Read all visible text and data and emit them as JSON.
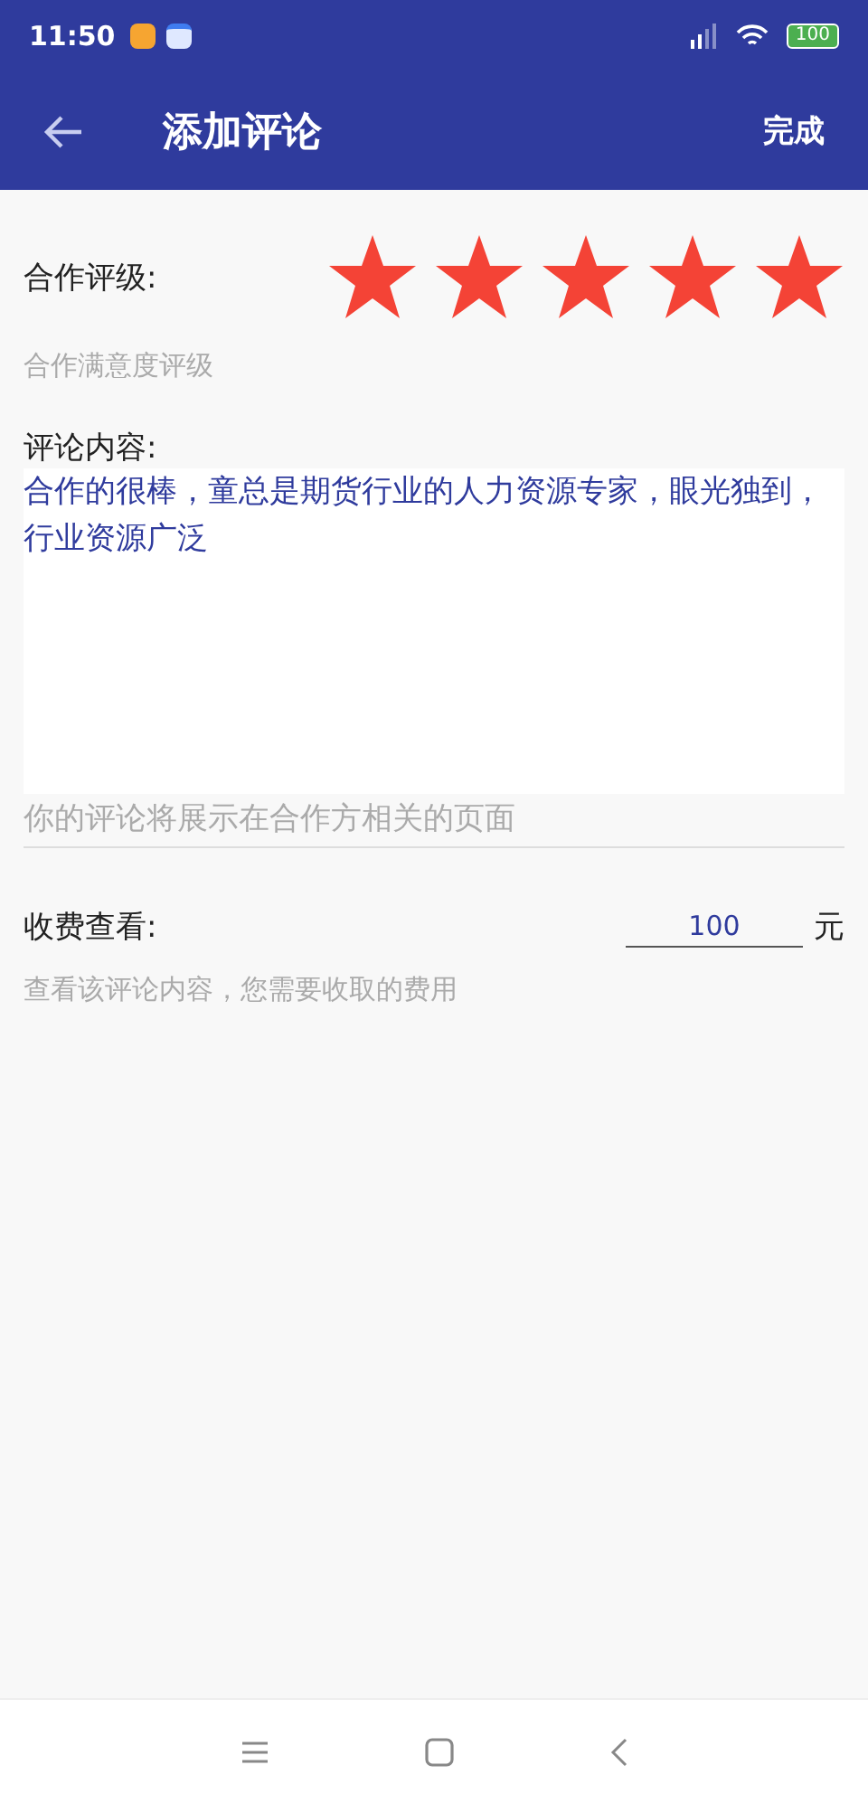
{
  "status_bar": {
    "time": "11:50",
    "battery": "100"
  },
  "app_bar": {
    "title": "添加评论",
    "action": "完成"
  },
  "rating": {
    "label": "合作评级:",
    "stars": 5,
    "hint": "合作满意度评级"
  },
  "comment": {
    "label": "评论内容:",
    "value": "合作的很棒，童总是期货行业的人力资源专家，眼光独到，行业资源广泛",
    "hint": "你的评论将展示在合作方相关的页面"
  },
  "fee": {
    "label": "收费查看:",
    "value": "100",
    "unit": "元",
    "hint": "查看该评论内容，您需要收取的费用"
  }
}
